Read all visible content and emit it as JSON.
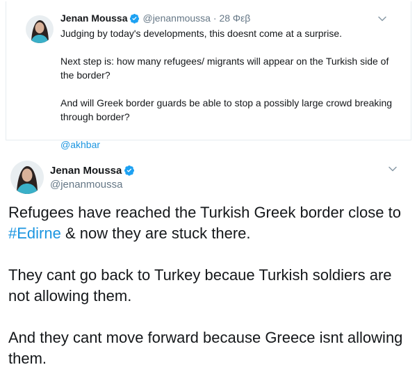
{
  "quoted_tweet": {
    "author_name": "Jenan Moussa",
    "handle": "@jenanmoussa",
    "separator": "·",
    "date": "28 Φεβ",
    "paragraphs": [
      "Judging by today's developments, this doesnt come at a surprise.",
      "Next step is: how many refugees/ migrants will appear on the Turkish side of the border?",
      "And will Greek border guards be able to stop a possibly large crowd breaking through border?"
    ],
    "mention": "@akhbar"
  },
  "main_tweet": {
    "author_name": "Jenan Moussa",
    "handle": "@jenanmoussa",
    "para1_before": "Refugees have reached the Turkish Greek border close to ",
    "hashtag": "#Edirne",
    "para1_after": " & now they are stuck there.",
    "para2": "They cant go back to Turkey becaue Turkish soldiers are not allowing them.",
    "para3": "And they cant move forward because Greece isnt allowing them."
  },
  "colors": {
    "link": "#1b95e0",
    "verified": "#1da1f2",
    "secondary_text": "#657786"
  },
  "icons": [
    "verified-badge-icon",
    "chevron-down-icon"
  ]
}
